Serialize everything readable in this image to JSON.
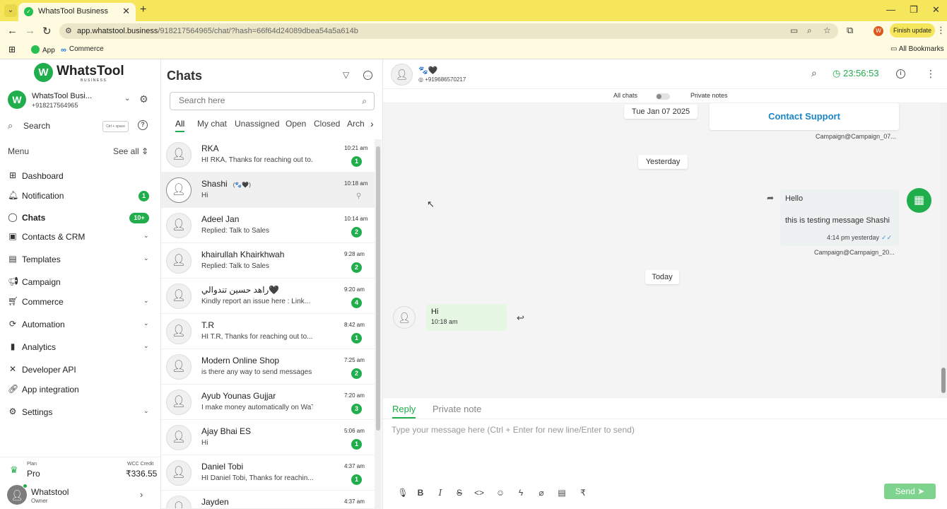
{
  "browser": {
    "tab_title": "WhatsTool Business",
    "url_host": "app.whatstool.business",
    "url_path": "/918217564965/chat/?hash=66f64d24089dbea54a5a614b",
    "profile_initial": "W",
    "finish_update": "Finish update",
    "bookmarks": [
      "App",
      "Commerce"
    ],
    "all_bookmarks": "All Bookmarks"
  },
  "sidebar": {
    "logo_text": "WhatsTool",
    "logo_sub": "BUSINESS",
    "account_name": "WhatsTool Busi...",
    "account_phone": "+918217564965",
    "search_label": "Search",
    "search_shortcut": "Ctrl + space",
    "menu_label": "Menu",
    "see_all": "See all",
    "items": [
      {
        "label": "Dashboard",
        "icon": "grid-icon"
      },
      {
        "label": "Notification",
        "icon": "bell-icon",
        "badge": "1"
      },
      {
        "label": "Chats",
        "icon": "chat-icon",
        "badge": "10+"
      },
      {
        "label": "Contacts & CRM",
        "icon": "contacts-icon"
      },
      {
        "label": "Templates",
        "icon": "template-icon"
      },
      {
        "label": "Campaign",
        "icon": "megaphone-icon"
      },
      {
        "label": "Commerce",
        "icon": "cart-icon"
      },
      {
        "label": "Automation",
        "icon": "automation-icon"
      },
      {
        "label": "Analytics",
        "icon": "analytics-icon"
      },
      {
        "label": "Developer API",
        "icon": "api-icon"
      },
      {
        "label": "App integration",
        "icon": "link-icon"
      },
      {
        "label": "Settings",
        "icon": "gear-icon"
      }
    ],
    "plan_label": "Plan",
    "plan_value": "Pro",
    "wcc_label": "WCC Credit",
    "wcc_value": "₹336.55",
    "user_name": "Whatstool",
    "user_role": "Owner"
  },
  "chatlist": {
    "title": "Chats",
    "search_placeholder": "Search here",
    "tabs": [
      "All",
      "My chat",
      "Unassigned",
      "Open",
      "Closed",
      "Arch"
    ],
    "chats": [
      {
        "name": "RKA",
        "preview": "HI RKA, Thanks for reaching out to...",
        "time": "10:21 am",
        "unread": "1"
      },
      {
        "name": "Shashi",
        "emoji": "(🐾🖤)",
        "preview": "Hi",
        "time": "10:18 am",
        "unread": ""
      },
      {
        "name": "Adeel Jan",
        "preview": "Replied: Talk to Sales",
        "time": "10:14 am",
        "unread": "2"
      },
      {
        "name": "khairullah Khairkhwah",
        "preview": "Replied: Talk to Sales",
        "time": "9:28 am",
        "unread": "2"
      },
      {
        "name": "راهد حسين تندوالي🖤",
        "preview": "Kindly report an issue here : Link...",
        "time": "9:20 am",
        "unread": "4"
      },
      {
        "name": "T.R",
        "preview": "HI T.R, Thanks for reaching out to...",
        "time": "8:42 am",
        "unread": "1"
      },
      {
        "name": "Modern Online Shop",
        "preview": "is there any way to send messages t...",
        "time": "7:25 am",
        "unread": "2"
      },
      {
        "name": "Ayub Younas Gujjar",
        "preview": "I make money automatically on WaToo...",
        "time": "7:20 am",
        "unread": "3"
      },
      {
        "name": "Ajay Bhai ES",
        "preview": "Hi",
        "time": "5:06 am",
        "unread": "1"
      },
      {
        "name": "Daniel Tobi",
        "preview": "HI Daniel Tobi, Thanks for reachin...",
        "time": "4:37 am",
        "unread": "1"
      },
      {
        "name": "Jayden",
        "preview": "",
        "time": "4:37 am",
        "unread": ""
      }
    ]
  },
  "conversation": {
    "contact_name": "🐾🖤",
    "contact_phone": "+919686570217",
    "timer": "23:56:53",
    "toggle_left": "All chats",
    "toggle_right": "Private notes",
    "date_1": "Tue Jan 07 2025",
    "support_button": "Contact Support",
    "campaign_1": "Campaign@Campaign_07...",
    "date_2": "Yesterday",
    "out_line_1": "Hello",
    "out_line_2": "this is testing message Shashi",
    "out_time": "4:14 pm yesterday",
    "campaign_2": "Campaign@Campaign_20...",
    "date_3": "Today",
    "in_text": "Hi",
    "in_time": "10:18 am"
  },
  "composer": {
    "tab_reply": "Reply",
    "tab_private": "Private note",
    "placeholder": "Type your message here (Ctrl + Enter for new line/Enter to send)",
    "send_label": "Send"
  }
}
